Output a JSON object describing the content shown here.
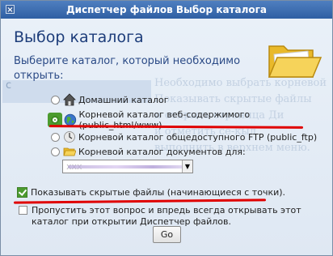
{
  "window": {
    "title": "Диспетчер файлов Выбор каталога"
  },
  "heading": "Выбор каталога",
  "subheading": "Выберите каталог, который необходимо открыть:",
  "options": [
    {
      "label": "Домашний каталог",
      "icon": "home-icon",
      "selected": false
    },
    {
      "label": "Корневой каталог веб-содержимого (public_html/www)",
      "icon": "globe-icon",
      "selected": true
    },
    {
      "label": "Корневой каталог общедоступного FTP (public_ftp)",
      "icon": "ftp-icon",
      "selected": false
    },
    {
      "label": "Корневой каталог документов для:",
      "icon": "folder-icon",
      "selected": false
    }
  ],
  "domain_select": {
    "value": "xxx"
  },
  "show_hidden": {
    "label": "Показывать скрытые файлы (начинающиеся с точки).",
    "checked": true
  },
  "remember": {
    "label": "Пропустить этот вопрос и впредь всегда открывать этот каталог при открытии Диспетчер файлов.",
    "checked": false
  },
  "go_button": "Go",
  "background_text": {
    "side": "c",
    "lines": [
      "Необходимо выбрать корневой",
      "Показывать скрытые файлы",
      "и открыть страница Ди",
      "и отметить се-кыл",
      "выполнить в верхнем меню."
    ]
  },
  "colors": {
    "accent_red": "#e00000",
    "selected_green": "#4c9b2f",
    "heading_blue": "#1d3d7a"
  }
}
